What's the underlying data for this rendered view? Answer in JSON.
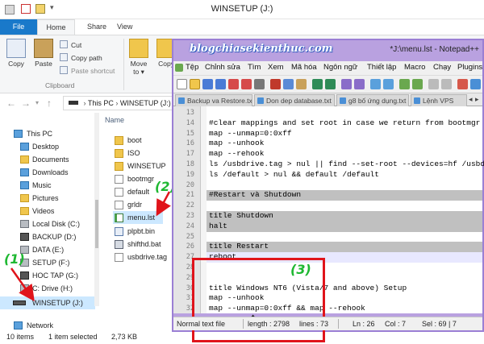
{
  "explorer": {
    "title": "WINSETUP (J:)",
    "tabs": [
      "File",
      "Home",
      "Share",
      "View"
    ],
    "ribbon": {
      "copy": "Copy",
      "paste": "Paste",
      "cut": "Cut",
      "copy_path": "Copy path",
      "paste_shortcut": "Paste shortcut",
      "clipboard_group": "Clipboard",
      "move_to": "Move",
      "move_to_2": "to ▾",
      "copy_to": "Copy"
    },
    "breadcrumb": [
      "This PC",
      "WINSETUP (J:)"
    ],
    "nav": [
      "This PC",
      "Desktop",
      "Documents",
      "Downloads",
      "Music",
      "Pictures",
      "Videos",
      "Local Disk (C:)",
      "BACKUP (D:)",
      "DATA (E:)",
      "SETUP (F:)",
      "HOC TAP (G:)",
      "C: Drive (H:)",
      "WINSETUP (J:)",
      "Network"
    ],
    "column_header": "Name",
    "files": [
      "boot",
      "ISO",
      "WINSETUP",
      "bootmgr",
      "default",
      "grldr",
      "menu.lst",
      "plpbt.bin",
      "shifthd.bat",
      "usbdrive.tag"
    ],
    "status": {
      "items": "10 items",
      "selected": "1 item selected",
      "size": "2,73 KB"
    }
  },
  "annotations": [
    "(1)",
    "(2)",
    "(3)"
  ],
  "notepad": {
    "title": "*J:\\menu.lst - Notepad++",
    "watermark": "blogchiasekienthuc.com",
    "menu": [
      "Tệp",
      "Chỉnh sửa",
      "Tìm",
      "Xem",
      "Mã hóa",
      "Ngôn ngữ",
      "Thiết lập",
      "Macro",
      "Chạy",
      "Plugins"
    ],
    "tabs": [
      "Backup va Restore.txt",
      "Don dep database.txt",
      "g8 bố ứng dụng.txt",
      "Lệnh VPS"
    ],
    "lines": [
      {
        "n": "13",
        "text": ""
      },
      {
        "n": "14",
        "text": "#clear mappings and set root in case we return from bootmgr"
      },
      {
        "n": "15",
        "text": "map --unmap=0:0xff"
      },
      {
        "n": "16",
        "text": "map --unhook"
      },
      {
        "n": "17",
        "text": "map --rehook"
      },
      {
        "n": "18",
        "text": "ls /usbdrive.tag > nul || find --set-root --devices=hf /usbdrive"
      },
      {
        "n": "19",
        "text": "ls /default > nul && default /default"
      },
      {
        "n": "20",
        "text": ""
      },
      {
        "n": "21",
        "text": "#Restart và Shutdown"
      },
      {
        "n": "22",
        "text": ""
      },
      {
        "n": "23",
        "text": "title Shutdown"
      },
      {
        "n": "24",
        "text": "halt"
      },
      {
        "n": "25",
        "text": ""
      },
      {
        "n": "26",
        "text": "title Restart"
      },
      {
        "n": "27",
        "text": "reboot"
      },
      {
        "n": "28",
        "text": ""
      },
      {
        "n": "29",
        "text": ""
      },
      {
        "n": "30",
        "text": "title Windows NT6 (Vista/7 and above) Setup"
      },
      {
        "n": "31",
        "text": "map --unhook"
      },
      {
        "n": "32",
        "text": "map --unmap=0:0xff && map --rehook"
      }
    ],
    "status": {
      "type": "Normal text file",
      "length": "length : 2798",
      "lines": "lines : 73",
      "ln": "Ln : 26",
      "col": "Col : 7",
      "sel": "Sel : 69 | 7"
    }
  },
  "colors": {
    "accent": "#1979ca",
    "npp_frame": "#b9a1e0",
    "annotation_green": "#1fb832",
    "annotation_red": "#e0141b"
  }
}
